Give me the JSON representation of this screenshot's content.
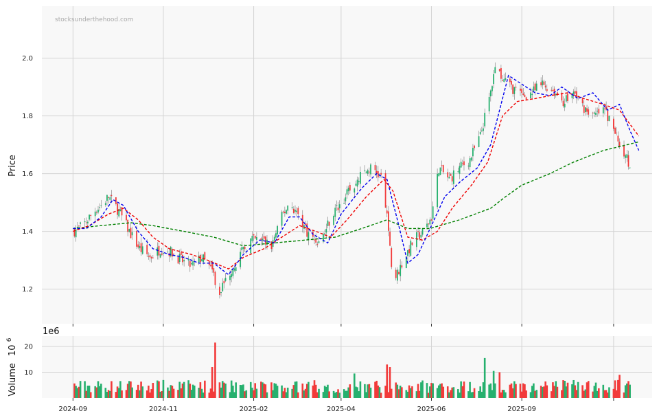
{
  "watermark": "stocksunderthehood.com",
  "colors": {
    "up": "#26b06e",
    "down": "#f23a3a",
    "ma_short": "#0000ee",
    "ma_mid": "#ee0000",
    "ma_long": "#008000",
    "panel_bg": "#f8f8f8"
  },
  "chart_data": {
    "type": "candlestick",
    "ylabel": "Price",
    "ylim": [
      1.08,
      2.18
    ],
    "yticks": [
      1.2,
      1.4,
      1.6,
      1.8,
      2.0
    ],
    "ytick_labels": [
      "1.2",
      "1.4",
      "1.6",
      "1.8",
      "2.0"
    ],
    "x_start": "2024-08-11",
    "x_end": "2025-09-27",
    "xticks": [
      "2024-09-01",
      "2024-11-01",
      "2025-01-01",
      "2025-03-01",
      "2025-05-01",
      "2025-07-01",
      "2025-09-01"
    ],
    "xtick_labels": [
      "2024-09",
      "2024-11",
      "2025-02",
      "2025-04",
      "2025-06",
      "2025-09"
    ],
    "xtick_label_dates": [
      "2024-09-01",
      "2024-11-01",
      "2025-01-01",
      "2025-03-01",
      "2025-05-01",
      "2025-07-01",
      "2025-09-01"
    ],
    "grid": true,
    "price_path": [
      [
        "2024-09-01",
        1.4
      ],
      [
        "2024-09-08",
        1.42
      ],
      [
        "2024-09-15",
        1.47
      ],
      [
        "2024-09-20",
        1.49
      ],
      [
        "2024-09-25",
        1.52
      ],
      [
        "2024-10-02",
        1.47
      ],
      [
        "2024-10-09",
        1.4
      ],
      [
        "2024-10-16",
        1.34
      ],
      [
        "2024-10-23",
        1.31
      ],
      [
        "2024-10-30",
        1.34
      ],
      [
        "2024-11-06",
        1.33
      ],
      [
        "2024-11-13",
        1.3
      ],
      [
        "2024-11-20",
        1.28
      ],
      [
        "2024-11-27",
        1.31
      ],
      [
        "2024-12-04",
        1.26
      ],
      [
        "2024-12-09",
        1.19
      ],
      [
        "2024-12-16",
        1.26
      ],
      [
        "2024-12-23",
        1.32
      ],
      [
        "2024-12-30",
        1.37
      ],
      [
        "2025-01-06",
        1.37
      ],
      [
        "2025-01-13",
        1.35
      ],
      [
        "2025-01-20",
        1.45
      ],
      [
        "2025-01-25",
        1.5
      ],
      [
        "2025-02-01",
        1.45
      ],
      [
        "2025-02-08",
        1.38
      ],
      [
        "2025-02-15",
        1.36
      ],
      [
        "2025-02-22",
        1.45
      ],
      [
        "2025-03-01",
        1.5
      ],
      [
        "2025-03-08",
        1.55
      ],
      [
        "2025-03-15",
        1.6
      ],
      [
        "2025-03-22",
        1.62
      ],
      [
        "2025-03-29",
        1.58
      ],
      [
        "2025-04-02",
        1.4
      ],
      [
        "2025-04-05",
        1.22
      ],
      [
        "2025-04-12",
        1.3
      ],
      [
        "2025-04-19",
        1.37
      ],
      [
        "2025-04-26",
        1.4
      ],
      [
        "2025-05-01",
        1.45
      ],
      [
        "2025-05-06",
        1.62
      ],
      [
        "2025-05-13",
        1.58
      ],
      [
        "2025-05-20",
        1.62
      ],
      [
        "2025-05-27",
        1.65
      ],
      [
        "2025-06-03",
        1.73
      ],
      [
        "2025-06-10",
        1.88
      ],
      [
        "2025-06-14",
        2.02
      ],
      [
        "2025-06-17",
        1.93
      ],
      [
        "2025-06-24",
        1.9
      ],
      [
        "2025-07-01",
        1.87
      ],
      [
        "2025-07-08",
        1.88
      ],
      [
        "2025-07-15",
        1.91
      ],
      [
        "2025-07-22",
        1.89
      ],
      [
        "2025-07-29",
        1.85
      ],
      [
        "2025-08-05",
        1.88
      ],
      [
        "2025-08-12",
        1.83
      ],
      [
        "2025-08-19",
        1.8
      ],
      [
        "2025-08-26",
        1.82
      ],
      [
        "2025-09-02",
        1.74
      ],
      [
        "2025-09-09",
        1.66
      ],
      [
        "2025-09-14",
        1.62
      ]
    ],
    "ma_short": [
      [
        "2024-09-01",
        1.41
      ],
      [
        "2024-09-10",
        1.41
      ],
      [
        "2024-09-20",
        1.45
      ],
      [
        "2024-09-28",
        1.51
      ],
      [
        "2024-10-05",
        1.49
      ],
      [
        "2024-10-15",
        1.4
      ],
      [
        "2024-10-25",
        1.34
      ],
      [
        "2024-11-05",
        1.32
      ],
      [
        "2024-11-15",
        1.31
      ],
      [
        "2024-11-25",
        1.29
      ],
      [
        "2024-12-05",
        1.29
      ],
      [
        "2024-12-15",
        1.25
      ],
      [
        "2024-12-25",
        1.32
      ],
      [
        "2025-01-05",
        1.37
      ],
      [
        "2025-01-15",
        1.36
      ],
      [
        "2025-01-25",
        1.45
      ],
      [
        "2025-02-01",
        1.45
      ],
      [
        "2025-02-10",
        1.39
      ],
      [
        "2025-02-20",
        1.36
      ],
      [
        "2025-03-01",
        1.46
      ],
      [
        "2025-03-15",
        1.55
      ],
      [
        "2025-03-25",
        1.6
      ],
      [
        "2025-04-01",
        1.58
      ],
      [
        "2025-04-08",
        1.44
      ],
      [
        "2025-04-15",
        1.29
      ],
      [
        "2025-04-22",
        1.32
      ],
      [
        "2025-05-01",
        1.42
      ],
      [
        "2025-05-10",
        1.52
      ],
      [
        "2025-05-20",
        1.57
      ],
      [
        "2025-06-01",
        1.62
      ],
      [
        "2025-06-10",
        1.7
      ],
      [
        "2025-06-15",
        1.8
      ],
      [
        "2025-06-22",
        1.94
      ],
      [
        "2025-07-01",
        1.91
      ],
      [
        "2025-07-10",
        1.88
      ],
      [
        "2025-07-20",
        1.87
      ],
      [
        "2025-07-28",
        1.9
      ],
      [
        "2025-08-08",
        1.86
      ],
      [
        "2025-08-18",
        1.88
      ],
      [
        "2025-08-28",
        1.82
      ],
      [
        "2025-09-05",
        1.84
      ],
      [
        "2025-09-12",
        1.75
      ],
      [
        "2025-09-18",
        1.68
      ]
    ],
    "ma_mid": [
      [
        "2024-09-01",
        1.4
      ],
      [
        "2024-09-12",
        1.42
      ],
      [
        "2024-09-25",
        1.46
      ],
      [
        "2024-10-05",
        1.48
      ],
      [
        "2024-10-15",
        1.44
      ],
      [
        "2024-10-25",
        1.38
      ],
      [
        "2024-11-05",
        1.34
      ],
      [
        "2024-11-20",
        1.32
      ],
      [
        "2024-12-01",
        1.3
      ],
      [
        "2024-12-15",
        1.27
      ],
      [
        "2024-12-25",
        1.31
      ],
      [
        "2025-01-08",
        1.34
      ],
      [
        "2025-01-20",
        1.38
      ],
      [
        "2025-02-01",
        1.42
      ],
      [
        "2025-02-12",
        1.4
      ],
      [
        "2025-02-22",
        1.38
      ],
      [
        "2025-03-05",
        1.44
      ],
      [
        "2025-03-18",
        1.52
      ],
      [
        "2025-03-30",
        1.58
      ],
      [
        "2025-04-05",
        1.54
      ],
      [
        "2025-04-15",
        1.38
      ],
      [
        "2025-04-25",
        1.37
      ],
      [
        "2025-05-05",
        1.4
      ],
      [
        "2025-05-15",
        1.48
      ],
      [
        "2025-05-28",
        1.56
      ],
      [
        "2025-06-08",
        1.64
      ],
      [
        "2025-06-18",
        1.8
      ],
      [
        "2025-06-28",
        1.85
      ],
      [
        "2025-07-10",
        1.86
      ],
      [
        "2025-07-20",
        1.87
      ],
      [
        "2025-08-01",
        1.88
      ],
      [
        "2025-08-12",
        1.86
      ],
      [
        "2025-08-25",
        1.84
      ],
      [
        "2025-09-05",
        1.82
      ],
      [
        "2025-09-18",
        1.73
      ]
    ],
    "ma_long": [
      [
        "2024-09-01",
        1.41
      ],
      [
        "2024-09-20",
        1.42
      ],
      [
        "2024-10-10",
        1.43
      ],
      [
        "2024-10-25",
        1.42
      ],
      [
        "2024-11-15",
        1.4
      ],
      [
        "2024-12-05",
        1.38
      ],
      [
        "2024-12-25",
        1.35
      ],
      [
        "2025-01-15",
        1.36
      ],
      [
        "2025-02-05",
        1.37
      ],
      [
        "2025-02-25",
        1.38
      ],
      [
        "2025-03-15",
        1.41
      ],
      [
        "2025-04-01",
        1.44
      ],
      [
        "2025-04-15",
        1.41
      ],
      [
        "2025-04-30",
        1.41
      ],
      [
        "2025-05-20",
        1.44
      ],
      [
        "2025-06-10",
        1.48
      ],
      [
        "2025-06-20",
        1.52
      ],
      [
        "2025-07-01",
        1.56
      ],
      [
        "2025-07-20",
        1.6
      ],
      [
        "2025-08-05",
        1.64
      ],
      [
        "2025-08-25",
        1.68
      ],
      [
        "2025-09-10",
        1.7
      ],
      [
        "2025-09-18",
        1.71
      ]
    ],
    "volume": {
      "ylabel": "Volume",
      "exponent_label": "1e6",
      "unit_label": "10",
      "unit_exponent": "6",
      "ylim": [
        0,
        24
      ],
      "yticks": [
        10,
        20
      ],
      "ytick_labels": [
        "10",
        "20"
      ],
      "spikes": [
        [
          "2024-09-28",
          11
        ],
        [
          "2024-10-05",
          13.5
        ],
        [
          "2024-12-04",
          12
        ],
        [
          "2024-12-06",
          21.5
        ],
        [
          "2024-12-08",
          9
        ],
        [
          "2025-04-01",
          13
        ],
        [
          "2025-04-03",
          12
        ],
        [
          "2025-06-06",
          15.5
        ],
        [
          "2025-06-12",
          10.5
        ],
        [
          "2025-06-16",
          10
        ],
        [
          "2025-09-05",
          9
        ],
        [
          "2025-03-10",
          9.5
        ]
      ]
    }
  }
}
